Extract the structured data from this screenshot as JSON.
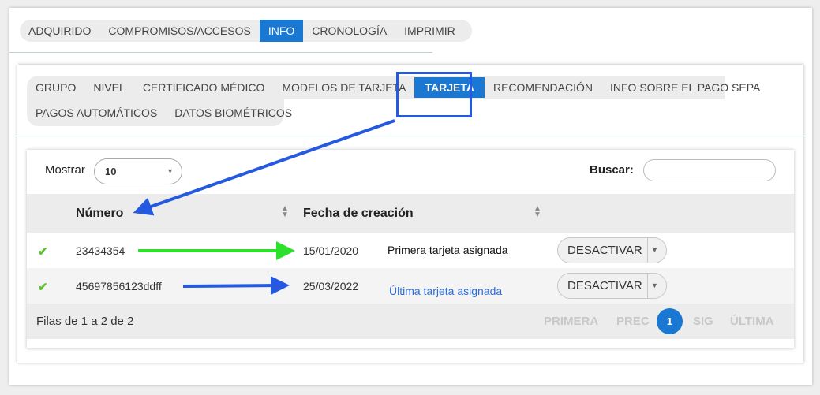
{
  "top_tabs": [
    "ADQUIRIDO",
    "COMPROMISOS/ACCESOS",
    "INFO",
    "CRONOLOGÍA",
    "IMPRIMIR"
  ],
  "top_active": "INFO",
  "sub_tabs_row1": [
    "GRUPO",
    "NIVEL",
    "CERTIFICADO MÉDICO",
    "MODELOS DE TARJETA",
    "TARJETA",
    "RECOMENDACIÓN",
    "INFO SOBRE EL PAGO SEPA"
  ],
  "sub_tabs_row2": [
    "PAGOS AUTOMÁTICOS",
    "DATOS BIOMÉTRICOS"
  ],
  "sub_active": "TARJETA",
  "controls": {
    "show_label": "Mostrar",
    "show_value": "10",
    "search_label": "Buscar:",
    "search_value": ""
  },
  "table": {
    "headers": {
      "number": "Número",
      "created": "Fecha de creación"
    },
    "rows": [
      {
        "number": "23434354",
        "date": "15/01/2020",
        "note": "Primera tarjeta asignada",
        "action": "DESACTIVAR"
      },
      {
        "number": "45697856123ddff",
        "date": "25/03/2022",
        "note": "Última tarjeta asignada",
        "action": "DESACTIVAR"
      }
    ]
  },
  "footer": {
    "info": "Filas de 1 a 2 de 2",
    "first": "PRIMERA",
    "prev": "PREC",
    "page": "1",
    "next": "SIG",
    "last": "ÚLTIMA"
  },
  "colors": {
    "accent": "#1a78d3",
    "annotation_blue": "#2459e0",
    "annotation_green": "#2ee02e"
  }
}
